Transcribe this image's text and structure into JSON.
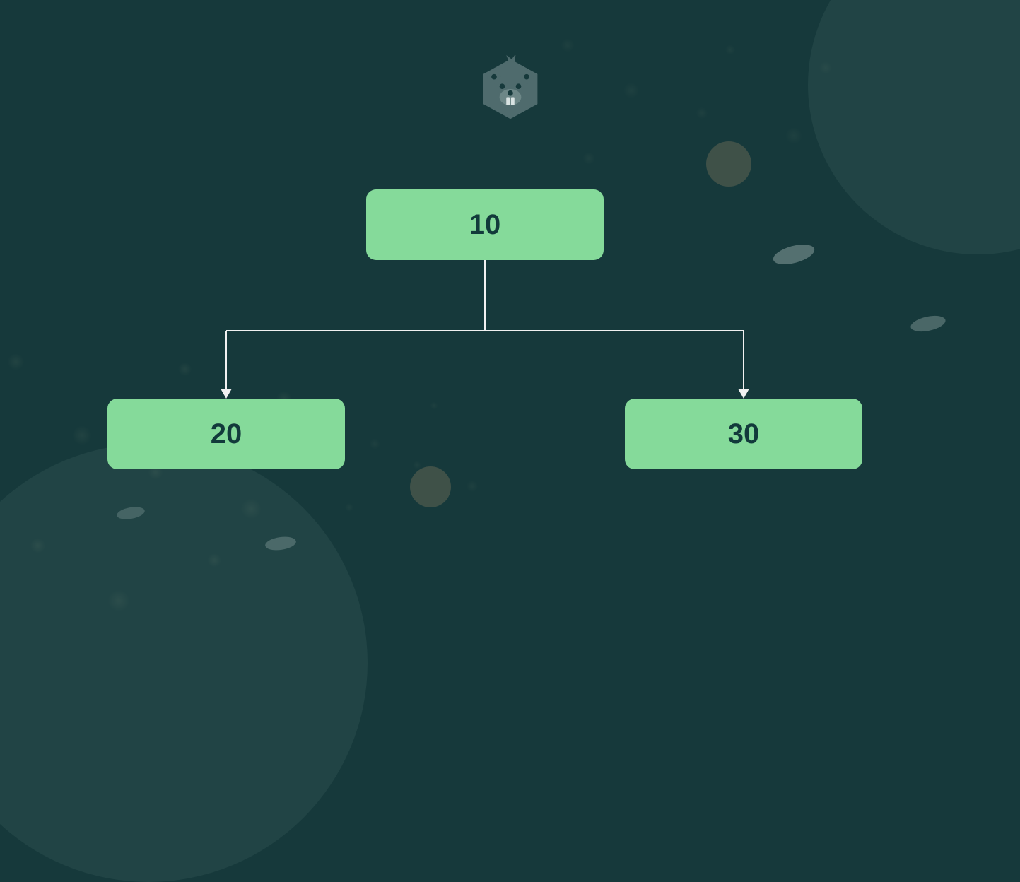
{
  "chart_data": {
    "type": "tree",
    "root": {
      "value": "10"
    },
    "children": [
      {
        "value": "20"
      },
      {
        "value": "30"
      }
    ]
  },
  "colors": {
    "node_bg": "#85da9a",
    "node_text": "#123a3b",
    "background": "#16393b",
    "connector": "#f1f1f1"
  },
  "icon": "beaver-logo"
}
